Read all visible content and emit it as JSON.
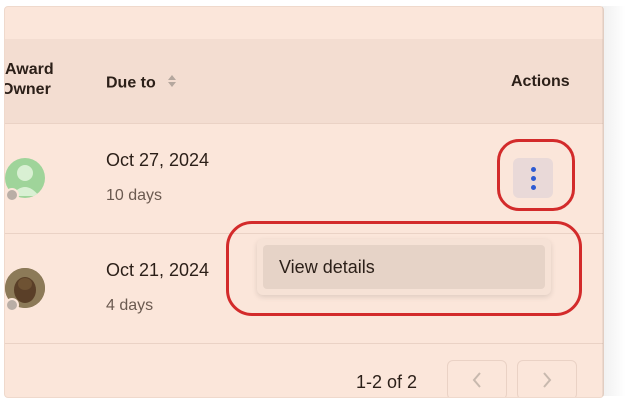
{
  "table": {
    "headers": {
      "award_owner": "Award Owner",
      "award_line1": "Award",
      "award_line2": "Owner",
      "due_to": "Due to",
      "actions": "Actions"
    },
    "rows": [
      {
        "date": "Oct 27, 2024",
        "days": "10 days",
        "avatar_icon": "user-avatar-placeholder"
      },
      {
        "date": "Oct 21, 2024",
        "days": "4 days",
        "avatar_icon": "user-avatar-photo"
      }
    ]
  },
  "menu": {
    "items": [
      {
        "label": "View details"
      }
    ]
  },
  "pagination": {
    "label": "1-2 of 2"
  },
  "colors": {
    "panel_bg": "#fbe6da",
    "header_bg": "#f3ddd1",
    "kebab_dot": "#2d5bd3",
    "highlight": "#d32b2b"
  }
}
